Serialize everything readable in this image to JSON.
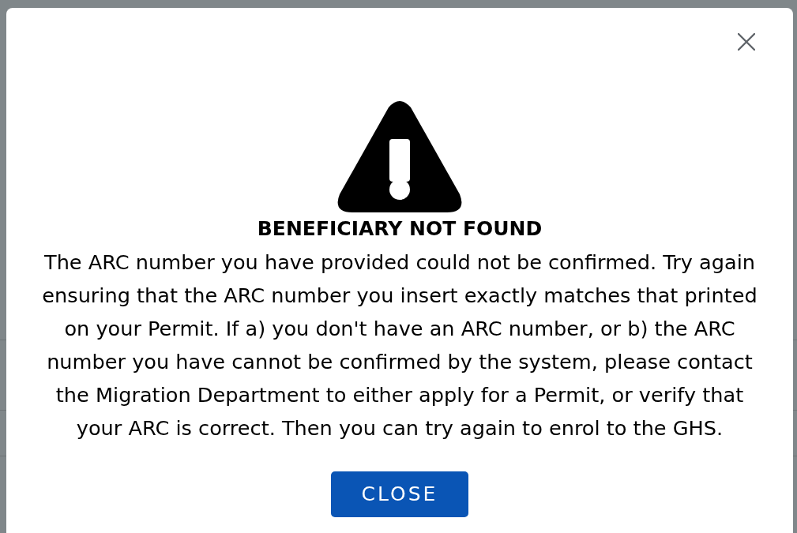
{
  "dialog": {
    "title": "BENEFICIARY NOT FOUND",
    "message": "The ARC number you have provided could not be confirmed. Try again ensuring that the ARC number you insert exactly matches that printed on your Permit. If a) you don't have an ARC number, or b) the ARC number you have cannot be confirmed by the system, please contact the Migration Department to either apply for a Permit, or verify that your ARC is correct. Then you can try again to enrol to the GHS.",
    "button": {
      "label": "CLOSE"
    }
  }
}
